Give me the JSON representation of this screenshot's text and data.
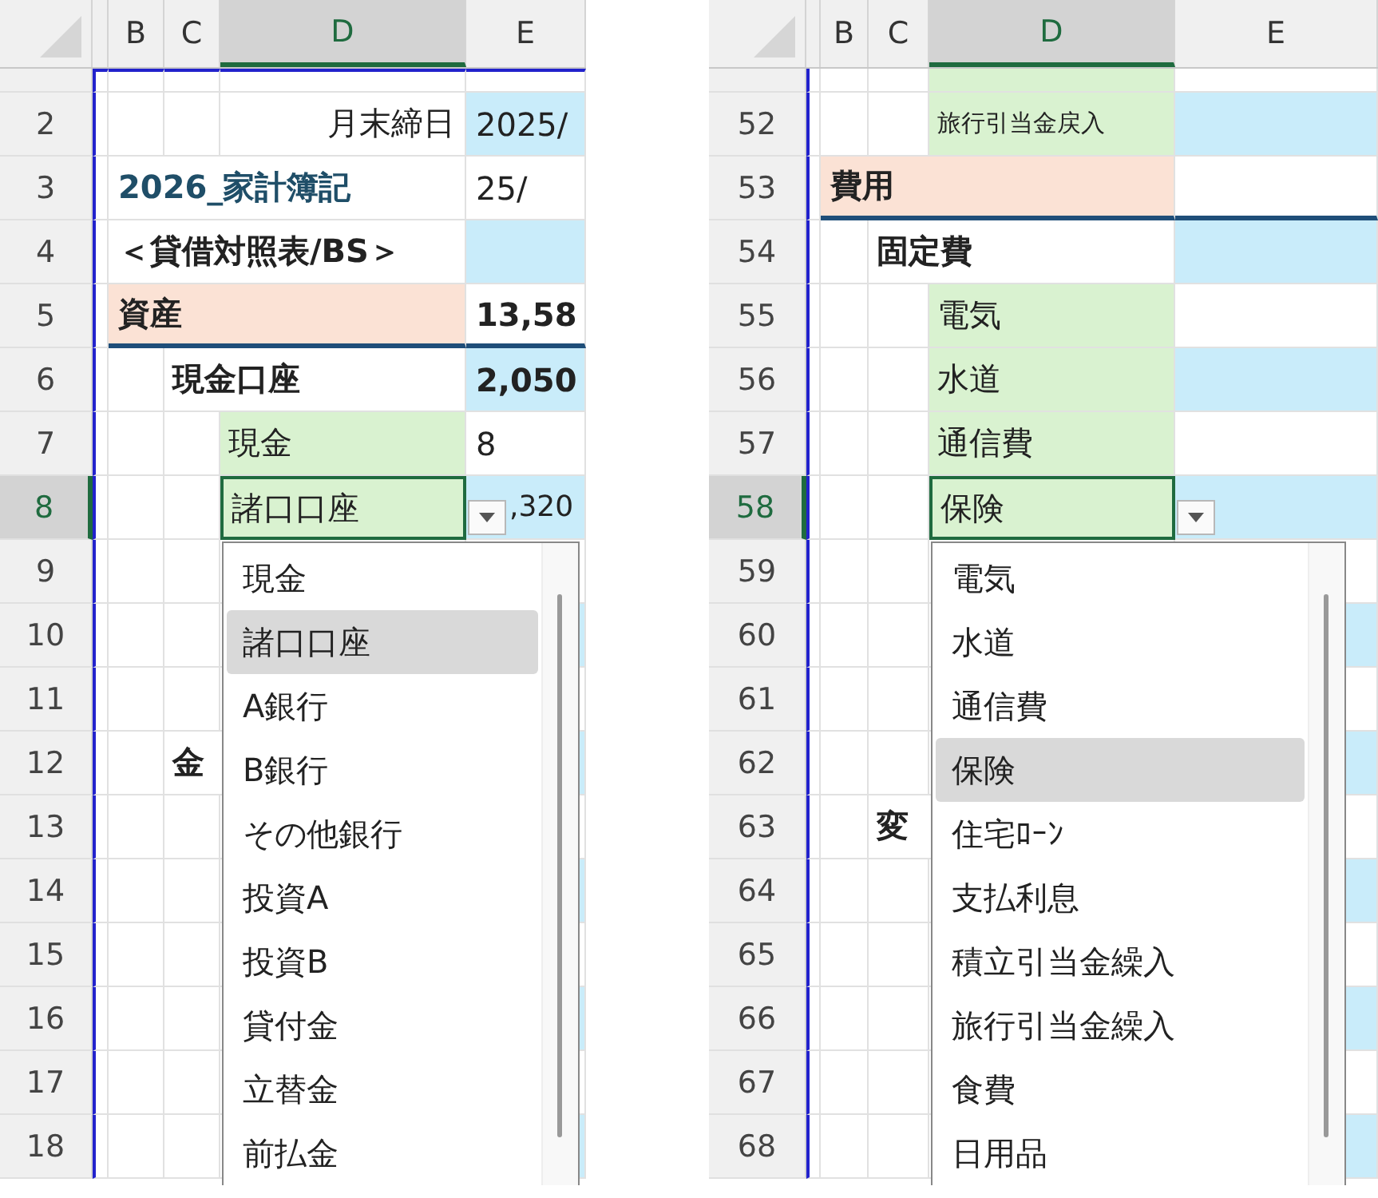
{
  "panes": [
    {
      "top_row": {
        "kind": "plain"
      },
      "columns": [
        {
          "label": "B",
          "selected": false
        },
        {
          "label": "C",
          "selected": false
        },
        {
          "label": "D",
          "selected": true
        },
        {
          "label": "E",
          "selected": false
        }
      ],
      "rows": [
        {
          "number": "2",
          "kind": "date",
          "band": true,
          "selected": false,
          "label": "月末締日",
          "value": "2025/"
        },
        {
          "number": "3",
          "kind": "title",
          "band": false,
          "selected": false,
          "label": "2026_家計簿記",
          "value": "25/"
        },
        {
          "number": "4",
          "kind": "heading",
          "band": true,
          "selected": false,
          "label": "＜貸借対照表/BS＞"
        },
        {
          "number": "5",
          "kind": "section",
          "band": false,
          "selected": false,
          "label": "資産",
          "value": "13,58"
        },
        {
          "number": "6",
          "kind": "group",
          "band": true,
          "selected": false,
          "label": "現金口座",
          "value": "2,050"
        },
        {
          "number": "7",
          "kind": "item",
          "band": false,
          "selected": false,
          "label": "現金",
          "value": "8"
        },
        {
          "number": "8",
          "kind": "item",
          "band": true,
          "selected": true,
          "label": "諸口口座",
          "value": ",320"
        },
        {
          "number": "9",
          "kind": "plain",
          "band": false,
          "selected": false
        },
        {
          "number": "10",
          "kind": "plain",
          "band": true,
          "selected": false
        },
        {
          "number": "11",
          "kind": "plain",
          "band": false,
          "selected": false
        },
        {
          "number": "12",
          "kind": "group",
          "band": true,
          "selected": false,
          "label": "金"
        },
        {
          "number": "13",
          "kind": "plain",
          "band": false,
          "selected": false
        },
        {
          "number": "14",
          "kind": "plain",
          "band": true,
          "selected": false
        },
        {
          "number": "15",
          "kind": "plain",
          "band": false,
          "selected": false
        },
        {
          "number": "16",
          "kind": "plain",
          "band": true,
          "selected": false
        },
        {
          "number": "17",
          "kind": "plain",
          "band": false,
          "selected": false
        },
        {
          "number": "18",
          "kind": "plain",
          "band": true,
          "selected": false
        }
      ],
      "dropdown": [
        {
          "label": "現金",
          "selected": false
        },
        {
          "label": "諸口口座",
          "selected": true
        },
        {
          "label": "A銀行",
          "selected": false
        },
        {
          "label": "B銀行",
          "selected": false
        },
        {
          "label": "その他銀行",
          "selected": false
        },
        {
          "label": "投資A",
          "selected": false
        },
        {
          "label": "投資B",
          "selected": false
        },
        {
          "label": "貸付金",
          "selected": false
        },
        {
          "label": "立替金",
          "selected": false
        },
        {
          "label": "前払金",
          "selected": false
        }
      ]
    },
    {
      "top_row": {
        "kind": "item"
      },
      "columns": [
        {
          "label": "B",
          "selected": false
        },
        {
          "label": "C",
          "selected": false
        },
        {
          "label": "D",
          "selected": true
        },
        {
          "label": "E",
          "selected": false
        }
      ],
      "rows": [
        {
          "number": "52",
          "kind": "item",
          "band": true,
          "selected": false,
          "small": true,
          "label": "旅行引当金戻入"
        },
        {
          "number": "53",
          "kind": "section",
          "band": false,
          "selected": false,
          "label": "費用"
        },
        {
          "number": "54",
          "kind": "group",
          "band": true,
          "selected": false,
          "label": "固定費"
        },
        {
          "number": "55",
          "kind": "item",
          "band": false,
          "selected": false,
          "label": "電気"
        },
        {
          "number": "56",
          "kind": "item",
          "band": true,
          "selected": false,
          "label": "水道"
        },
        {
          "number": "57",
          "kind": "item",
          "band": false,
          "selected": false,
          "label": "通信費"
        },
        {
          "number": "58",
          "kind": "item",
          "band": true,
          "selected": true,
          "label": "保険"
        },
        {
          "number": "59",
          "kind": "plain",
          "band": false,
          "selected": false
        },
        {
          "number": "60",
          "kind": "plain",
          "band": true,
          "selected": false
        },
        {
          "number": "61",
          "kind": "plain",
          "band": false,
          "selected": false
        },
        {
          "number": "62",
          "kind": "plain",
          "band": true,
          "selected": false
        },
        {
          "number": "63",
          "kind": "group",
          "band": false,
          "selected": false,
          "label": "変"
        },
        {
          "number": "64",
          "kind": "plain",
          "band": true,
          "selected": false
        },
        {
          "number": "65",
          "kind": "plain",
          "band": false,
          "selected": false
        },
        {
          "number": "66",
          "kind": "plain",
          "band": true,
          "selected": false
        },
        {
          "number": "67",
          "kind": "plain",
          "band": false,
          "selected": false
        },
        {
          "number": "68",
          "kind": "plain",
          "band": true,
          "selected": false
        }
      ],
      "dropdown": [
        {
          "label": "電気",
          "selected": false
        },
        {
          "label": "水道",
          "selected": false
        },
        {
          "label": "通信費",
          "selected": false
        },
        {
          "label": "保険",
          "selected": true
        },
        {
          "label": "住宅ﾛｰﾝ",
          "selected": false
        },
        {
          "label": "支払利息",
          "selected": false
        },
        {
          "label": "積立引当金繰入",
          "selected": false
        },
        {
          "label": "旅行引当金繰入",
          "selected": false
        },
        {
          "label": "食費",
          "selected": false
        },
        {
          "label": "日用品",
          "selected": false
        }
      ]
    }
  ]
}
